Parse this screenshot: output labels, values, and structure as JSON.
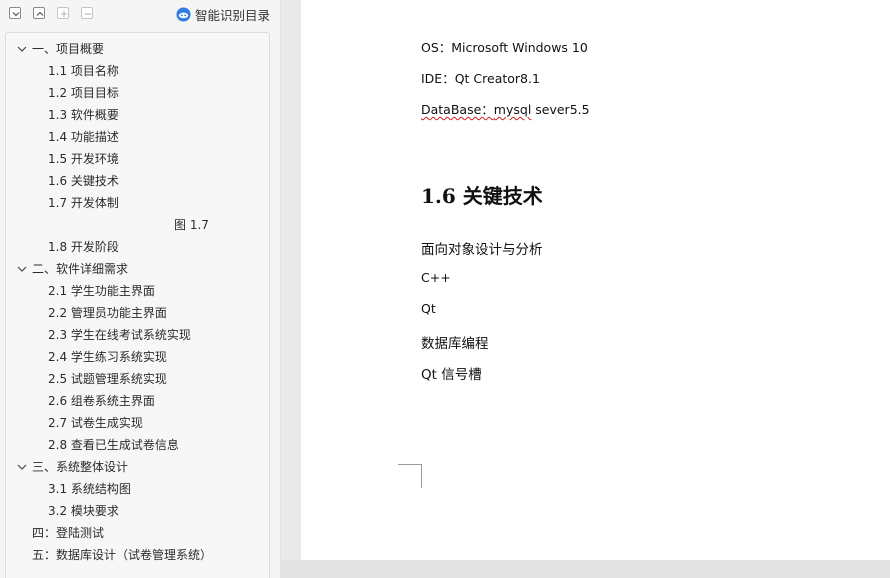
{
  "nav": {
    "toolbar": {
      "smart_toc_label": "智能识别目录"
    },
    "items": [
      {
        "label": "一、项目概要",
        "level": 0,
        "expanded": true
      },
      {
        "label": "1.1 项目名称",
        "level": 1
      },
      {
        "label": "1.2 项目目标",
        "level": 1
      },
      {
        "label": "1.3 软件概要",
        "level": 1
      },
      {
        "label": "1.4 功能描述",
        "level": 1
      },
      {
        "label": "1.5 开发环境",
        "level": 1
      },
      {
        "label": "1.6 关键技术",
        "level": 1
      },
      {
        "label": "1.7 开发体制",
        "level": 1
      },
      {
        "label": "图 1.7",
        "level": 3
      },
      {
        "label": "1.8 开发阶段",
        "level": 1
      },
      {
        "label": "二、软件详细需求",
        "level": 0,
        "expanded": true
      },
      {
        "label": "2.1 学生功能主界面",
        "level": 1
      },
      {
        "label": "2.2 管理员功能主界面",
        "level": 1
      },
      {
        "label": "2.3  学生在线考试系统实现",
        "level": 1
      },
      {
        "label": "2.4  学生练习系统实现",
        "level": 1
      },
      {
        "label": "2.5 试题管理系统实现",
        "level": 1
      },
      {
        "label": "2.6 组卷系统主界面",
        "level": 1
      },
      {
        "label": "2.7  试卷生成实现",
        "level": 1
      },
      {
        "label": "2.8 查看已生成试卷信息",
        "level": 1
      },
      {
        "label": "三、系统整体设计",
        "level": 0,
        "expanded": true
      },
      {
        "label": "3.1 系统结构图",
        "level": 1
      },
      {
        "label": "3.2 模块要求",
        "level": 1
      },
      {
        "label": "四：登陆测试",
        "level": 0
      },
      {
        "label": "五：数据库设计（试卷管理系统）",
        "level": 0
      }
    ]
  },
  "doc": {
    "env": {
      "os": "OS：Microsoft Windows 10",
      "ide": "IDE：Qt Creator8.1",
      "db_prefix": "DataBase：",
      "db_word1": "mysql",
      "db_rest": " sever5.5"
    },
    "section_heading": "1.6 关键技术",
    "tech_items": [
      "面向对象设计与分析",
      "C++",
      "Qt",
      "数据库编程",
      "Qt 信号槽"
    ]
  },
  "colors": {
    "accent": "#2f7de1",
    "spellcheck": "#d02020"
  }
}
